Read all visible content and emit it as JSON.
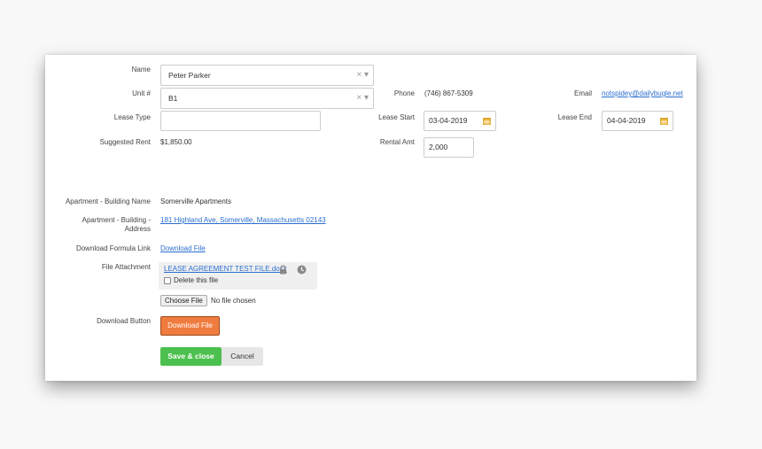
{
  "form": {
    "name": {
      "label": "Name",
      "value": "Peter Parker"
    },
    "unit": {
      "label": "Unit #",
      "value": "B1"
    },
    "lease_type": {
      "label": "Lease Type",
      "value": ""
    },
    "suggested_rent": {
      "label": "Suggested Rent",
      "value": "$1,850.00"
    },
    "phone": {
      "label": "Phone",
      "value": "(746) 867-5309"
    },
    "email": {
      "label": "Email",
      "value": "notspidey@dailybugle.net"
    },
    "lease_start": {
      "label": "Lease Start",
      "value": "03-04-2019"
    },
    "lease_end": {
      "label": "Lease End",
      "value": "04-04-2019"
    },
    "rental_amt": {
      "label": "Rental Amt",
      "value": "2,000"
    },
    "building_name": {
      "label": "Apartment - Building Name",
      "value": "Somerville Apartments"
    },
    "building_address": {
      "label_line1": "Apartment - Building -",
      "label_line2": "Address",
      "value": "181 Highland Ave, Somerville, Massachusetts 02143"
    },
    "download_formula": {
      "label": "Download Formula Link",
      "value": "Download File"
    },
    "file_attachment": {
      "label": "File Attachment",
      "file_name": "LEASE AGREEMENT TEST FILE.docx",
      "delete_label": "Delete this file",
      "choose_label": "Choose File",
      "no_file_text": "No file chosen"
    },
    "download_button": {
      "label": "Download Button",
      "button_label": "Download File"
    }
  },
  "actions": {
    "save_label": "Save & close",
    "cancel_label": "Cancel"
  },
  "icons": {
    "clear": "×",
    "dropdown": "▾"
  },
  "colors": {
    "link": "#2a6ed1",
    "orange_button": "#f07b3f",
    "save_button": "#4cc04e",
    "calendar_icon": "#e8b33d"
  }
}
